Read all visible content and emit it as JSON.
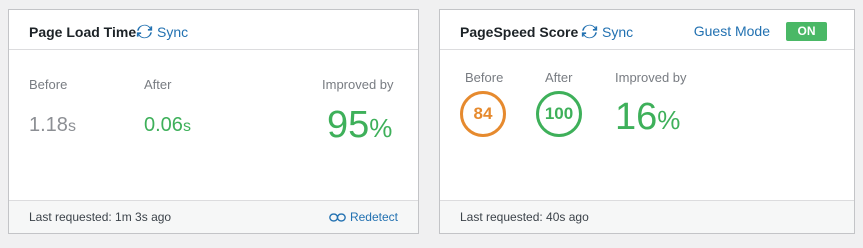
{
  "page_load": {
    "title": "Page Load Time",
    "sync_label": "Sync",
    "before_label": "Before",
    "before_value": "1.18",
    "before_unit": "s",
    "after_label": "After",
    "after_value": "0.06",
    "after_unit": "s",
    "improved_label": "Improved by",
    "improved_value": "95",
    "improved_unit": "%",
    "footer": "Last requested: 1m 3s ago",
    "redetect_label": "Redetect"
  },
  "pagespeed": {
    "title": "PageSpeed Score",
    "sync_label": "Sync",
    "guest_mode_label": "Guest Mode",
    "guest_mode_toggle": "ON",
    "before_label": "Before",
    "before_score": "84",
    "after_label": "After",
    "after_score": "100",
    "improved_label": "Improved by",
    "improved_value": "16",
    "improved_unit": "%",
    "footer": "Last requested: 40s ago"
  },
  "colors": {
    "accent": "#2271b1",
    "good": "#3eb05a",
    "average": "#e68a2e"
  }
}
